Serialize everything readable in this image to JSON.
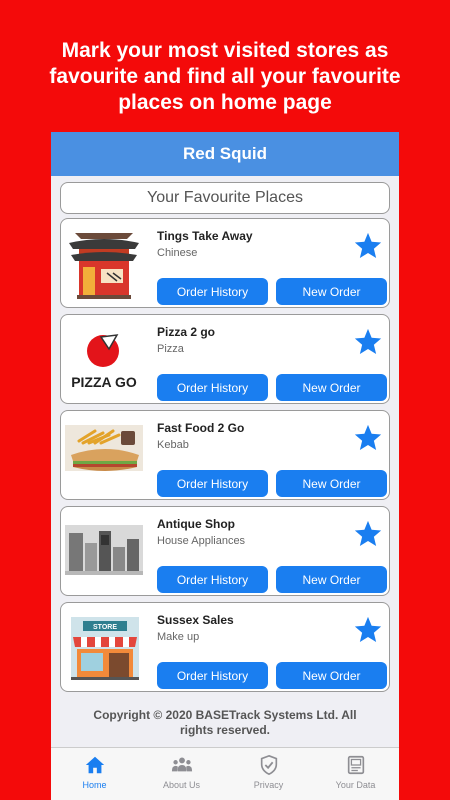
{
  "promo": {
    "line1": "Mark your most visited stores as",
    "line2": "favourite and find all your favourite",
    "line3": "places on home page"
  },
  "app": {
    "title": "Red Squid",
    "section_title": "Your Favourite Places",
    "stores": [
      {
        "name": "Tings Take Away",
        "category": "Chinese",
        "image": "chinese-pagoda-shop-illustration",
        "order_history": "Order History",
        "new_order": "New Order"
      },
      {
        "name": "Pizza 2 go",
        "category": "Pizza",
        "image": "pizza-go-logo",
        "logo_text": "PIZZA GO",
        "order_history": "Order History",
        "new_order": "New Order"
      },
      {
        "name": "Fast Food 2 Go",
        "category": "Kebab",
        "image": "fries-and-sandwich-photo",
        "order_history": "Order History",
        "new_order": "New Order"
      },
      {
        "name": "Antique Shop",
        "category": "House Appliances",
        "image": "appliances-photo",
        "order_history": "Order History",
        "new_order": "New Order"
      },
      {
        "name": "Sussex Sales",
        "category": "Make up",
        "image": "store-front-illustration",
        "sign_text": "STORE",
        "order_history": "Order History",
        "new_order": "New Order"
      }
    ],
    "copyright_line1": "Copyright © 2020 BASETrack Systems Ltd. All",
    "copyright_line2": "rights reserved.",
    "tabs": [
      {
        "label": "Home",
        "icon": "home-icon",
        "active": true
      },
      {
        "label": "About Us",
        "icon": "people-icon",
        "active": false
      },
      {
        "label": "Privacy",
        "icon": "shield-icon",
        "active": false
      },
      {
        "label": "Your Data",
        "icon": "document-icon",
        "active": false
      }
    ]
  },
  "colors": {
    "background": "#f40a0a",
    "appbar": "#4a90e2",
    "button": "#1a7ef0",
    "star": "#1a7ef0"
  }
}
